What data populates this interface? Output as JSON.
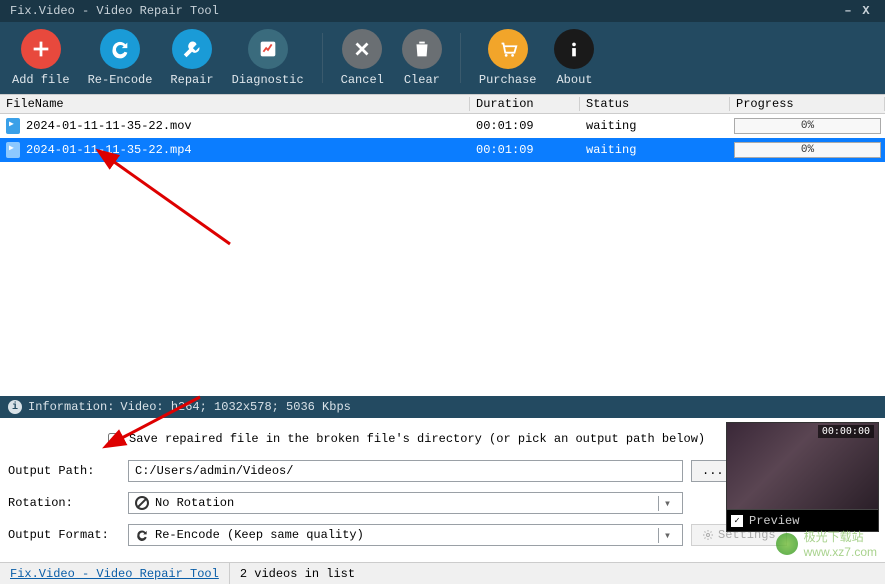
{
  "titlebar": {
    "title": "Fix.Video - Video Repair Tool"
  },
  "toolbar": {
    "add_file": "Add file",
    "re_encode": "Re-Encode",
    "repair": "Repair",
    "diagnostic": "Diagnostic",
    "cancel": "Cancel",
    "clear": "Clear",
    "purchase": "Purchase",
    "about": "About"
  },
  "columns": {
    "filename": "FileName",
    "duration": "Duration",
    "status": "Status",
    "progress": "Progress"
  },
  "files": [
    {
      "name": "2024-01-11-11-35-22.mov",
      "duration": "00:01:09",
      "status": "waiting",
      "progress": "0%",
      "selected": false
    },
    {
      "name": "2024-01-11-11-35-22.mp4",
      "duration": "00:01:09",
      "status": "waiting",
      "progress": "0%",
      "selected": true
    }
  ],
  "info": {
    "label": "Information:",
    "text": "Video: h264; 1032x578; 5036 Kbps"
  },
  "options": {
    "save_broken_label": "Save repaired file in the broken file's directory (or pick an output path below)",
    "output_path_label": "Output Path:",
    "output_path_value": "C:/Users/admin/Videos/",
    "browse_btn": "...",
    "rotation_label": "Rotation:",
    "rotation_value": "No Rotation",
    "output_format_label": "Output Format:",
    "output_format_value": "Re-Encode (Keep same quality)",
    "settings_btn": "Settings"
  },
  "preview": {
    "time": "00:00:00",
    "label": "Preview"
  },
  "statusbar": {
    "link": "Fix.Video - Video Repair Tool",
    "count": "2 videos in list"
  },
  "watermark": {
    "text": "极光下载站",
    "url": "www.xz7.com"
  }
}
